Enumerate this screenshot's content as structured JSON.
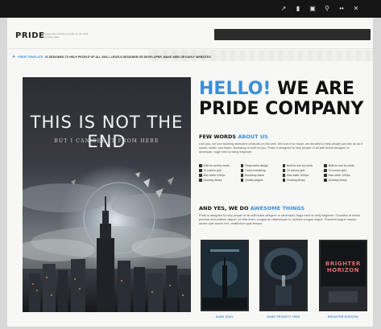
{
  "browser": {
    "toolbar_icons": [
      "pin-icon",
      "tab-icon",
      "page-icon",
      "bookmark-icon",
      "more-icon",
      "close-icon"
    ],
    "toolbar_glyphs": [
      "↗",
      "▮",
      "▣",
      "⚲",
      "••",
      "✕"
    ]
  },
  "header": {
    "logo": "PRIDE",
    "tagline": "Responsive website template by the pride company team"
  },
  "ticker": {
    "label": "PRIDE TEMPLATE",
    "text": "IS DESIGNED TO HELP PEOPLE OF ALL SKILL LEVELS DESIGNER OR DEVELOPER, MAKE WEB OR EARLY WEBSITES"
  },
  "poster": {
    "title": "THIS IS NOT THE END",
    "subtitle": "BUT I CAN SEE IT FROM HERE"
  },
  "hero": {
    "hello": "HELLO!",
    "we_are": "WE ARE",
    "company": "PRIDE COMPANY"
  },
  "about": {
    "heading_a": "FEW WORDS",
    "heading_b": "ABOUT US",
    "body": "Like you, we love building awesome products on the web. We love it so much, we decided to help people just like us do it easier, better, and faster. Bootstrap is built for you. Pride is designed to help people of all skill levels designer or developer, huge nerd or early beginner."
  },
  "features": [
    "Built for and by nerds",
    "Responsive design",
    "Built for and by nerds",
    "Built for and by nerds",
    "10 column grid",
    "Cross everything",
    "10 column grid",
    "10 column grid",
    "Max width 1000px",
    "Bootstrap ideas",
    "Max width 1000px",
    "Max width 1000px",
    "Growing library",
    "Quality plugins",
    "Growing library",
    "Growing library"
  ],
  "work": {
    "heading_a": "AND YES, WE DO",
    "heading_b": "AWESOME THINGS",
    "body": "Pride is designed to help people of all skill levels designer or developer, huge nerd or early beginner. Curabitur id lectus pulvinar and pretium aliquet. Ut felis enim, congue ac ullamcorper in, facilisis congue neque. Praesent augue mauris, auctor quis auctor nec, vestibulum quis tempor."
  },
  "thumbnails": [
    {
      "caption": "DARK SOUL",
      "text": ""
    },
    {
      "caption": "DARK PRIORITY TREE",
      "text": ""
    },
    {
      "caption": "BRIGHTER HORIZON",
      "text": "BRIGHTER HORIZON"
    }
  ],
  "colors": {
    "accent": "#3c8fd6",
    "topbar": "#151515",
    "page": "#f7f7f5"
  }
}
